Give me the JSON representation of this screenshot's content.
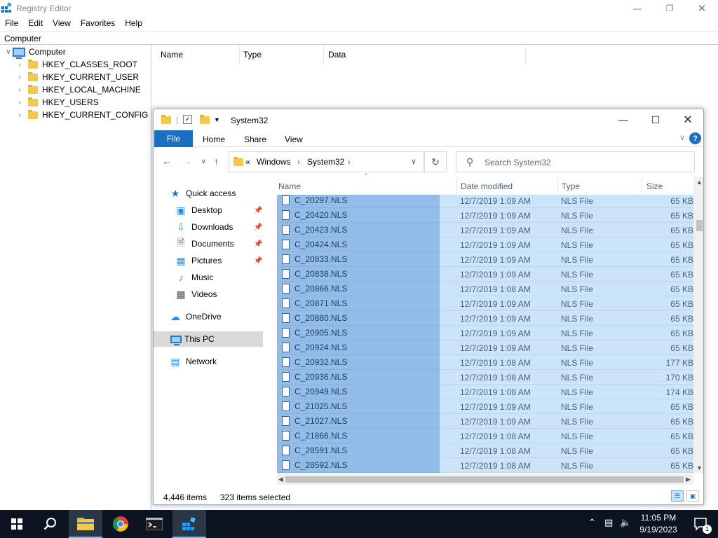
{
  "registry": {
    "title": "Registry Editor",
    "menu": [
      "File",
      "Edit",
      "View",
      "Favorites",
      "Help"
    ],
    "address": "Computer",
    "tree": {
      "root": "Computer",
      "keys": [
        "HKEY_CLASSES_ROOT",
        "HKEY_CURRENT_USER",
        "HKEY_LOCAL_MACHINE",
        "HKEY_USERS",
        "HKEY_CURRENT_CONFIG"
      ]
    },
    "columns": [
      "Name",
      "Type",
      "Data"
    ]
  },
  "explorer": {
    "title": "System32",
    "tabs": {
      "file": "File",
      "home": "Home",
      "share": "Share",
      "view": "View"
    },
    "help": "?",
    "breadcrumb": {
      "prefix": "«",
      "parts": [
        "Windows",
        "System32"
      ]
    },
    "search": {
      "placeholder": "Search System32"
    },
    "nav": {
      "quick_access": "Quick access",
      "desktop": "Desktop",
      "downloads": "Downloads",
      "documents": "Documents",
      "pictures": "Pictures",
      "music": "Music",
      "videos": "Videos",
      "onedrive": "OneDrive",
      "thispc": "This PC",
      "network": "Network"
    },
    "columns": {
      "name": "Name",
      "date": "Date modified",
      "type": "Type",
      "size": "Size"
    },
    "files": [
      {
        "name": "C_20297.NLS",
        "date": "12/7/2019 1:09 AM",
        "type": "NLS File",
        "size": "65 KB"
      },
      {
        "name": "C_20420.NLS",
        "date": "12/7/2019 1:09 AM",
        "type": "NLS File",
        "size": "65 KB"
      },
      {
        "name": "C_20423.NLS",
        "date": "12/7/2019 1:09 AM",
        "type": "NLS File",
        "size": "65 KB"
      },
      {
        "name": "C_20424.NLS",
        "date": "12/7/2019 1:09 AM",
        "type": "NLS File",
        "size": "65 KB"
      },
      {
        "name": "C_20833.NLS",
        "date": "12/7/2019 1:09 AM",
        "type": "NLS File",
        "size": "65 KB"
      },
      {
        "name": "C_20838.NLS",
        "date": "12/7/2019 1:09 AM",
        "type": "NLS File",
        "size": "65 KB"
      },
      {
        "name": "C_20866.NLS",
        "date": "12/7/2019 1:08 AM",
        "type": "NLS File",
        "size": "65 KB"
      },
      {
        "name": "C_20871.NLS",
        "date": "12/7/2019 1:09 AM",
        "type": "NLS File",
        "size": "65 KB"
      },
      {
        "name": "C_20880.NLS",
        "date": "12/7/2019 1:09 AM",
        "type": "NLS File",
        "size": "65 KB"
      },
      {
        "name": "C_20905.NLS",
        "date": "12/7/2019 1:09 AM",
        "type": "NLS File",
        "size": "65 KB"
      },
      {
        "name": "C_20924.NLS",
        "date": "12/7/2019 1:09 AM",
        "type": "NLS File",
        "size": "65 KB"
      },
      {
        "name": "C_20932.NLS",
        "date": "12/7/2019 1:08 AM",
        "type": "NLS File",
        "size": "177 KB"
      },
      {
        "name": "C_20936.NLS",
        "date": "12/7/2019 1:08 AM",
        "type": "NLS File",
        "size": "170 KB"
      },
      {
        "name": "C_20949.NLS",
        "date": "12/7/2019 1:08 AM",
        "type": "NLS File",
        "size": "174 KB"
      },
      {
        "name": "C_21025.NLS",
        "date": "12/7/2019 1:09 AM",
        "type": "NLS File",
        "size": "65 KB"
      },
      {
        "name": "C_21027.NLS",
        "date": "12/7/2019 1:09 AM",
        "type": "NLS File",
        "size": "65 KB"
      },
      {
        "name": "C_21866.NLS",
        "date": "12/7/2019 1:08 AM",
        "type": "NLS File",
        "size": "65 KB"
      },
      {
        "name": "C_28591.NLS",
        "date": "12/7/2019 1:08 AM",
        "type": "NLS File",
        "size": "65 KB"
      },
      {
        "name": "C_28592.NLS",
        "date": "12/7/2019 1:08 AM",
        "type": "NLS File",
        "size": "65 KB"
      }
    ],
    "status": {
      "items": "4,446 items",
      "selected": "323 items selected"
    }
  },
  "taskbar": {
    "time": "11:05 PM",
    "date": "9/19/2023",
    "notifications": "1"
  },
  "colors": {
    "selection": "#cce4f7",
    "selection_name": "#93bde8",
    "accent": "#1a6fc2",
    "taskbar": "#0b1420"
  }
}
